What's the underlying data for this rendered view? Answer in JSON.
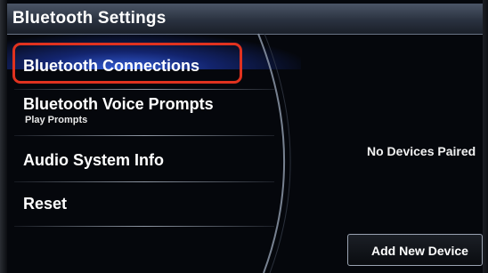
{
  "header": {
    "title": "Bluetooth Settings"
  },
  "menu": {
    "items": [
      {
        "label": "Bluetooth Connections",
        "sublabel": "",
        "selected": true
      },
      {
        "label": "Bluetooth Voice Prompts",
        "sublabel": "Play Prompts",
        "selected": false
      },
      {
        "label": "Audio System Info",
        "sublabel": "",
        "selected": false
      },
      {
        "label": "Reset",
        "sublabel": "",
        "selected": false
      }
    ]
  },
  "content": {
    "status_text": "No Devices Paired",
    "add_button_label": "Add New Device"
  },
  "colors": {
    "selection_outline": "#e0321f",
    "highlight_glow": "#3c6eff",
    "background": "#05070c"
  }
}
